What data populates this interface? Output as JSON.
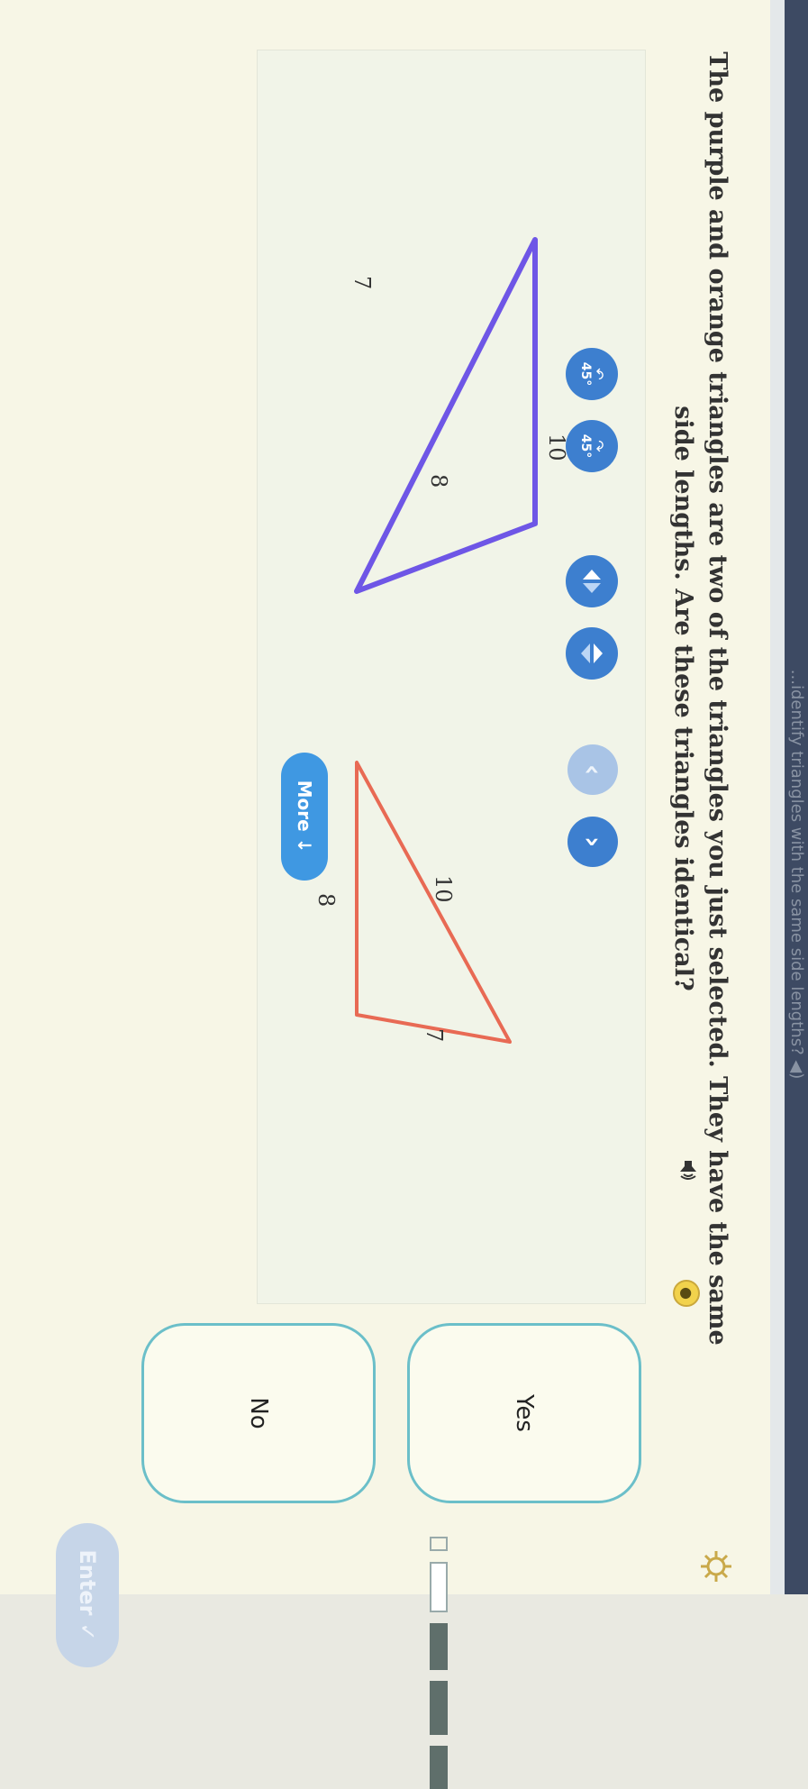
{
  "header": {
    "cropped_title": "...identify triangles with the same side lengths? ◀)"
  },
  "question": {
    "text": "The purple and orange triangles are two of the triangles you just selected. They have the same side lengths. Are these triangles identical?",
    "speaker_icon": "speaker-icon",
    "hint_icon": "lightbulb-icon"
  },
  "tools": {
    "rotate_left_label": "45°",
    "rotate_right_label": "45°",
    "flip_horizontal_icon": "flip-horizontal-icon",
    "flip_vertical_icon": "flip-vertical-icon",
    "prev_icon": "chevron-left-icon",
    "next_icon": "chevron-right-icon",
    "more_label": "More"
  },
  "triangles": {
    "purple": {
      "color": "#6e56e6",
      "labels": [
        "10",
        "7",
        "8"
      ]
    },
    "orange": {
      "color": "#e86a54",
      "labels": [
        "10",
        "7",
        "8"
      ]
    }
  },
  "answers": {
    "yes_label": "Yes",
    "no_label": "No"
  },
  "footer": {
    "enter_label": "Enter",
    "settings_icon": "gear-icon"
  },
  "colors": {
    "accent_blue": "#3d7fcf",
    "answer_border": "#6bbfc9",
    "hint_yellow": "#f2d24c"
  }
}
